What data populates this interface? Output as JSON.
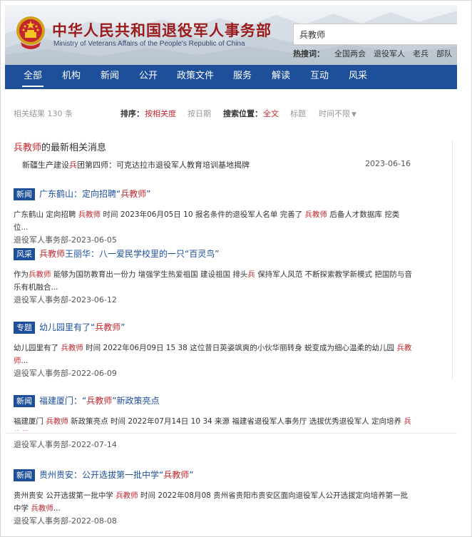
{
  "header": {
    "title": "中华人民共和国退役军人事务部",
    "subtitle": "Ministry of Veterans Affairs of the People's Republic of China"
  },
  "search": {
    "value": "兵教师",
    "hotwords_label": "热搜词：",
    "hotwords": [
      "全国两会",
      "退役军人",
      "老兵",
      "部队"
    ]
  },
  "nav": {
    "items": [
      "全部",
      "机构",
      "新闻",
      "公开",
      "政策文件",
      "服务",
      "解读",
      "互动",
      "风采"
    ],
    "active": "全部"
  },
  "filter": {
    "count_prefix": "相关结果",
    "count": "130",
    "count_suffix": "条",
    "sort_label": "排序：",
    "sort_relevance": "按相关度",
    "sort_date": "按日期",
    "scope_label": "搜索位置：",
    "scope_all": "全文",
    "scope_title": "标题",
    "time_limit": "时间不限"
  },
  "latest": {
    "title_highlight": "兵教师",
    "title_rest": "的最新相关消息",
    "item_pre": "新疆生产建设",
    "item_hl": "兵",
    "item_post": "团第四师：可克达拉市退役军人教育培训基地揭牌",
    "item_date": "2023-06-16"
  },
  "results": [
    {
      "badge": "新闻",
      "title_pre": "广东鹤山：定向招聘“",
      "title_hl": "兵教师",
      "title_post": "”",
      "snippet": [
        {
          "t": "广东鹤山 定向招聘 "
        },
        {
          "t": "兵教师",
          "hl": true
        },
        {
          "t": " 时间 2023年06月05日 10 报名条件的退役军人名单 完善了 "
        },
        {
          "t": "兵教师",
          "hl": true
        },
        {
          "t": " 后备人才数据库 挖类位..."
        }
      ],
      "source": "退役军人事务部-2023-06-05"
    },
    {
      "badge": "风采",
      "title_pre": "",
      "title_hl": "兵教师",
      "title_post": "王丽华：八一爱民学校里的一只“百灵鸟”",
      "snippet": [
        {
          "t": "作为"
        },
        {
          "t": "兵教师",
          "hl": true
        },
        {
          "t": " 能够为国防教育出一份力 增强学生热爱祖国 建设祖国 排头"
        },
        {
          "t": "兵",
          "hl": true
        },
        {
          "t": " 保持军人风范 不断探索教学新模式 把国防与音乐有机融合..."
        }
      ],
      "source": "退役军人事务部-2023-06-12"
    },
    {
      "badge": "专题",
      "title_pre": "幼儿园里有了“",
      "title_hl": "兵教师",
      "title_post": "”",
      "snippet": [
        {
          "t": "幼儿园里有了 "
        },
        {
          "t": "兵教师",
          "hl": true
        },
        {
          "t": " 时间 2022年06月09日 15 38 这位昔日英姿飒爽的小伙华丽转身 蜕变成为细心温柔的幼儿园 "
        },
        {
          "t": "兵教师",
          "hl": true
        },
        {
          "t": "..."
        }
      ],
      "source": "退役军人事务部-2022-06-09"
    },
    {
      "badge": "新闻",
      "title_pre": "福建厦门：“",
      "title_hl": "兵教师",
      "title_post": "”新政策亮点",
      "snippet": [
        {
          "t": "福建厦门 "
        },
        {
          "t": "兵教师",
          "hl": true
        },
        {
          "t": " 新政策亮点 时间 2022年07月14日 10 34 来源 福建省退役军人事务厅 选拔优秀退役军人 定向培养 "
        },
        {
          "t": "兵教师",
          "hl": true
        }
      ],
      "source": "退役军人事务部-2022-07-14"
    },
    {
      "badge": "新闻",
      "title_pre": "贵州贵安：公开选拔第一批中学“",
      "title_hl": "兵教师",
      "title_post": "”",
      "snippet": [
        {
          "t": "贵州贵安 公开选拔第一批中学 "
        },
        {
          "t": "兵教师",
          "hl": true
        },
        {
          "t": " 时间 2022年08月08 贵州省贵阳市贵安区面向退役军人公开选拔定向培养第一批中学 "
        },
        {
          "t": "兵教师",
          "hl": true
        },
        {
          "t": "..."
        }
      ],
      "source": "退役军人事务部-2022-08-08"
    }
  ],
  "colors": {
    "nav_bg": "#1d4f9b",
    "highlight": "#c4262e",
    "title_red": "#9b1b1b"
  },
  "icons": {
    "emblem": "national-emblem-icon",
    "dropdown": "caret-down-icon"
  }
}
